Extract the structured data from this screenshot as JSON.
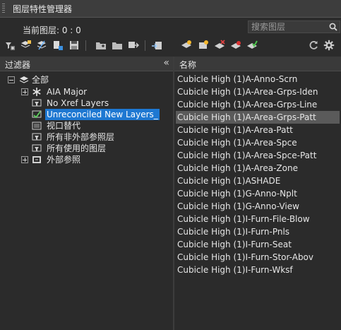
{
  "window": {
    "title": "图层特性管理器"
  },
  "status": {
    "current_layer": "当前图层: 0 : 0"
  },
  "search": {
    "placeholder": "搜索图层"
  },
  "toolbar": {
    "left_icons": [
      "new-property-filter-icon",
      "new-group-filter-icon",
      "layer-states-icon",
      "filter-settings-icon",
      "save-icon",
      "new-folder-icon",
      "open-folder-icon",
      "export-icon",
      "import-icon"
    ],
    "right_icons": [
      "new-layer-icon",
      "new-layer-vp-frozen-icon",
      "delete-layer-icon",
      "set-current-icon",
      "merge-layer-icon"
    ],
    "refresh_icon": "refresh-icon",
    "settings_icon": "gear-icon"
  },
  "filters_panel": {
    "header": "过滤器",
    "collapse_glyph": "«",
    "tree": [
      {
        "label": "全部",
        "level": 0,
        "expander": "minus",
        "icon": "layers-stack-icon"
      },
      {
        "label": "AIA Major",
        "level": 1,
        "expander": "plus",
        "icon": "asterisk-filter-icon"
      },
      {
        "label": "No Xref Layers",
        "level": 1,
        "expander": "",
        "icon": "filter-icon"
      },
      {
        "label": "Unreconciled New Layers_",
        "level": 1,
        "expander": "",
        "icon": "check-filter-icon",
        "selected": true
      },
      {
        "label": "视口替代",
        "level": 1,
        "expander": "",
        "icon": "viewport-filter-icon"
      },
      {
        "label": "所有非外部参照层",
        "level": 1,
        "expander": "",
        "icon": "filter-icon"
      },
      {
        "label": "所有使用的图层",
        "level": 1,
        "expander": "",
        "icon": "filter-icon"
      },
      {
        "label": "外部参照",
        "level": 1,
        "expander": "plus",
        "icon": "xref-filter-icon"
      }
    ]
  },
  "layers_panel": {
    "header": "名称",
    "rows": [
      "Cubicle High (1)A-Anno-Scrn",
      "Cubicle High (1)A-Area-Grps-Iden",
      "Cubicle High (1)A-Area-Grps-Line",
      "Cubicle High (1)A-Area-Grps-Patt",
      "Cubicle High (1)A-Area-Patt",
      "Cubicle High (1)A-Area-Spce",
      "Cubicle High (1)A-Area-Spce-Patt",
      "Cubicle High (1)A-Area-Zone",
      "Cubicle High (1)ASHADE",
      "Cubicle High (1)G-Anno-Nplt",
      "Cubicle High (1)G-Anno-View",
      "Cubicle High (1)I-Furn-File-Blow",
      "Cubicle High (1)I-Furn-Pnls",
      "Cubicle High (1)I-Furn-Seat",
      "Cubicle High (1)I-Furn-Stor-Abov",
      "Cubicle High (1)I-Furn-Wksf"
    ],
    "selected_index": 3
  },
  "colors": {
    "background": "#2b2b2b",
    "selection_blue": "#1e78d2",
    "selection_gray": "#5a5a5a"
  }
}
